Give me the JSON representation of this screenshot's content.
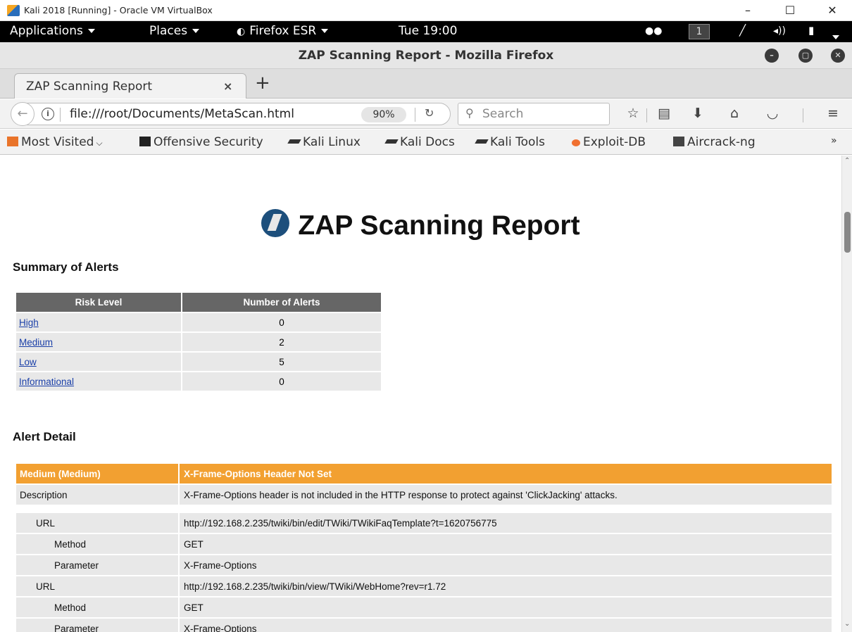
{
  "host": {
    "title": "Kali 2018 [Running] - Oracle VM VirtualBox",
    "minimize": "–",
    "maximize": "☐",
    "close": "✕"
  },
  "gnome": {
    "applications": "Applications",
    "places": "Places",
    "firefox": "Firefox ESR",
    "clock": "Tue 19:00",
    "workspace": "1"
  },
  "browser": {
    "window_title": "ZAP Scanning Report - Mozilla Firefox",
    "tab_label": "ZAP Scanning Report",
    "url": "file:///root/Documents/MetaScan.html",
    "zoom": "90%",
    "search_placeholder": "Search",
    "bookmarks": [
      {
        "label": "Most Visited",
        "icon": "folder-icon"
      },
      {
        "label": "Offensive Security",
        "icon": "offsec-icon"
      },
      {
        "label": "Kali Linux",
        "icon": "kali-icon"
      },
      {
        "label": "Kali Docs",
        "icon": "kali-icon"
      },
      {
        "label": "Kali Tools",
        "icon": "kali-icon"
      },
      {
        "label": "Exploit-DB",
        "icon": "exploitdb-icon"
      },
      {
        "label": "Aircrack-ng",
        "icon": "aircrack-icon"
      }
    ],
    "overflow": "»"
  },
  "report": {
    "title": "ZAP Scanning Report",
    "summary_heading": "Summary of Alerts",
    "summary_headers": [
      "Risk Level",
      "Number of Alerts"
    ],
    "summary_rows": [
      {
        "risk": "High",
        "count": "0"
      },
      {
        "risk": "Medium",
        "count": "2"
      },
      {
        "risk": "Low",
        "count": "5"
      },
      {
        "risk": "Informational",
        "count": "0"
      }
    ],
    "detail_heading": "Alert Detail",
    "alert": {
      "risk": "Medium (Medium)",
      "name": "X-Frame-Options Header Not Set",
      "description_label": "Description",
      "description": "X-Frame-Options header is not included in the HTTP response to protect against 'ClickJacking' attacks."
    },
    "instances": [
      {
        "url_label": "URL",
        "url": "http://192.168.2.235/twiki/bin/edit/TWiki/TWikiFaqTemplate?t=1620756775",
        "method_label": "Method",
        "method": "GET",
        "param_label": "Parameter",
        "param": "X-Frame-Options"
      },
      {
        "url_label": "URL",
        "url": "http://192.168.2.235/twiki/bin/view/TWiki/WebHome?rev=r1.72",
        "method_label": "Method",
        "method": "GET",
        "param_label": "Parameter",
        "param": "X-Frame-Options"
      }
    ]
  },
  "colors": {
    "alert_header": "#f2a031",
    "table_header": "#666666",
    "link": "#1a3fa8"
  }
}
